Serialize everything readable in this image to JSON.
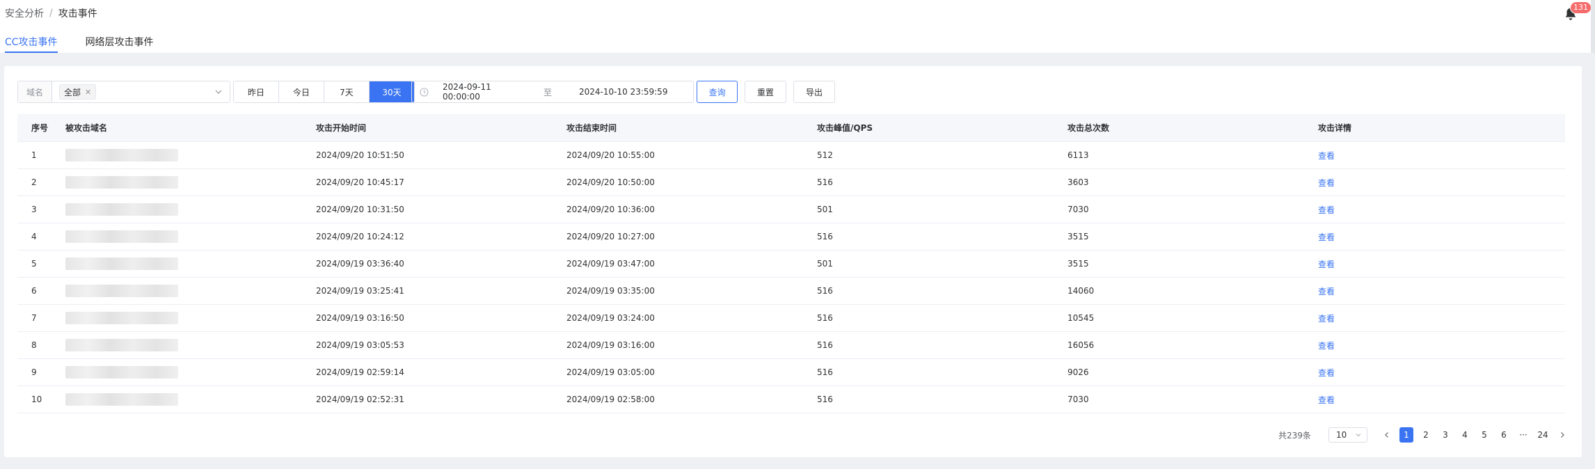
{
  "breadcrumb": {
    "parent": "安全分析",
    "separator": "/",
    "current": "攻击事件"
  },
  "notifications": {
    "count": "131"
  },
  "tabs": [
    {
      "label": "CC攻击事件",
      "active": true
    },
    {
      "label": "网络层攻击事件",
      "active": false
    }
  ],
  "filters": {
    "domain_label": "域名",
    "domain_tag": "全部",
    "quick_ranges": [
      "昨日",
      "今日",
      "7天",
      "30天"
    ],
    "active_range": "30天",
    "start_time": "2024-09-11 00:00:00",
    "range_separator": "至",
    "end_time": "2024-10-10 23:59:59",
    "query_label": "查询",
    "reset_label": "重置",
    "export_label": "导出"
  },
  "table": {
    "headers": [
      "序号",
      "被攻击域名",
      "攻击开始时间",
      "攻击结束时间",
      "攻击峰值/QPS",
      "攻击总次数",
      "攻击详情"
    ],
    "rows": [
      {
        "idx": "1",
        "start": "2024/09/20 10:51:50",
        "end": "2024/09/20 10:55:00",
        "qps": "512",
        "total": "6113",
        "detail": "查看"
      },
      {
        "idx": "2",
        "start": "2024/09/20 10:45:17",
        "end": "2024/09/20 10:50:00",
        "qps": "516",
        "total": "3603",
        "detail": "查看"
      },
      {
        "idx": "3",
        "start": "2024/09/20 10:31:50",
        "end": "2024/09/20 10:36:00",
        "qps": "501",
        "total": "7030",
        "detail": "查看"
      },
      {
        "idx": "4",
        "start": "2024/09/20 10:24:12",
        "end": "2024/09/20 10:27:00",
        "qps": "516",
        "total": "3515",
        "detail": "查看"
      },
      {
        "idx": "5",
        "start": "2024/09/19 03:36:40",
        "end": "2024/09/19 03:47:00",
        "qps": "501",
        "total": "3515",
        "detail": "查看"
      },
      {
        "idx": "6",
        "start": "2024/09/19 03:25:41",
        "end": "2024/09/19 03:35:00",
        "qps": "516",
        "total": "14060",
        "detail": "查看"
      },
      {
        "idx": "7",
        "start": "2024/09/19 03:16:50",
        "end": "2024/09/19 03:24:00",
        "qps": "516",
        "total": "10545",
        "detail": "查看"
      },
      {
        "idx": "8",
        "start": "2024/09/19 03:05:53",
        "end": "2024/09/19 03:16:00",
        "qps": "516",
        "total": "16056",
        "detail": "查看"
      },
      {
        "idx": "9",
        "start": "2024/09/19 02:59:14",
        "end": "2024/09/19 03:05:00",
        "qps": "516",
        "total": "9026",
        "detail": "查看"
      },
      {
        "idx": "10",
        "start": "2024/09/19 02:52:31",
        "end": "2024/09/19 02:58:00",
        "qps": "516",
        "total": "7030",
        "detail": "查看"
      }
    ]
  },
  "pagination": {
    "total_label": "共239条",
    "page_size": "10",
    "pages": [
      "1",
      "2",
      "3",
      "4",
      "5",
      "6",
      "···",
      "24"
    ],
    "current": "1"
  },
  "colors": {
    "accent": "#3a74f2",
    "badge": "#f56c6c",
    "page_bg": "#eef0f3"
  },
  "icons": {
    "bell": "bell-icon",
    "clock": "clock-icon",
    "close": "close-icon",
    "dropdown": "chevron-down-icon",
    "prev": "chevron-left-icon",
    "next": "chevron-right-icon"
  }
}
